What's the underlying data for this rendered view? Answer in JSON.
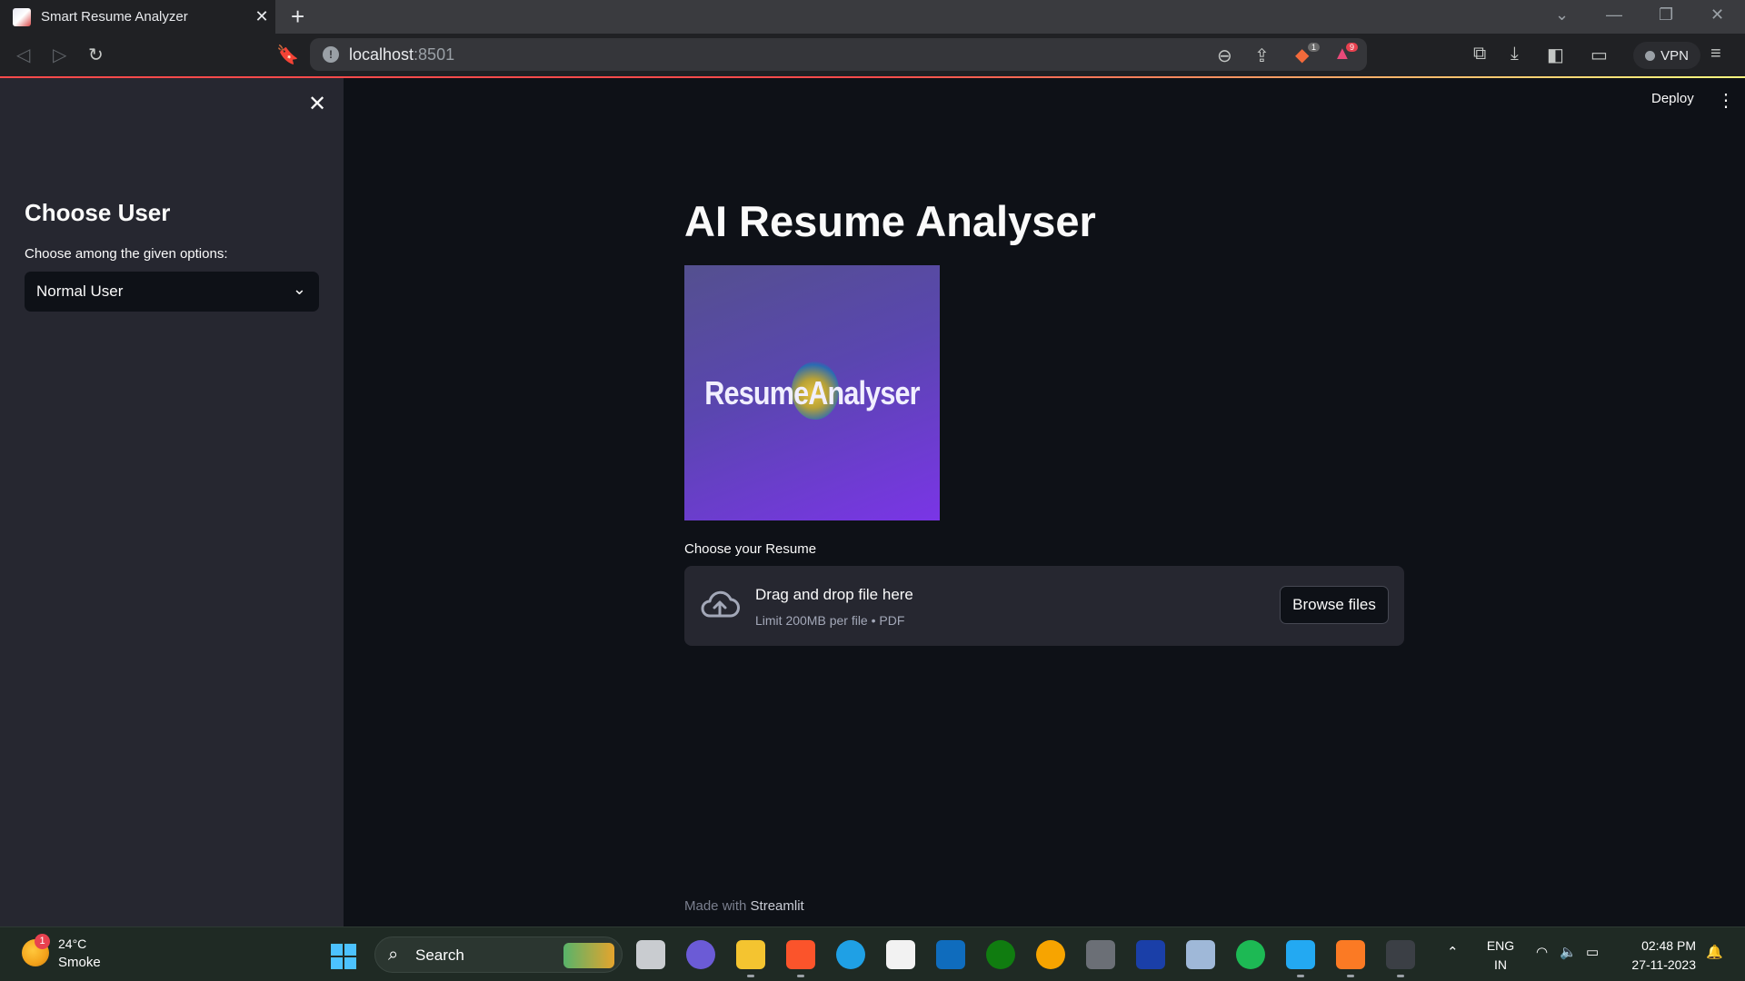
{
  "browser": {
    "tab_title": "Smart Resume Analyzer",
    "url_host": "localhost",
    "url_port": ":8501",
    "vpn_label": "VPN",
    "shield_count": "1",
    "alert_count": "9"
  },
  "header": {
    "deploy_label": "Deploy"
  },
  "sidebar": {
    "title": "Choose User",
    "select_label": "Choose among the given options:",
    "select_value": "Normal User"
  },
  "main": {
    "title": "AI Resume Analyser",
    "hero_logo_text": "ResumeAnalyser",
    "uploader": {
      "label": "Choose your Resume",
      "drop_text": "Drag and drop file here",
      "limit_text": "Limit 200MB per file • PDF",
      "browse_label": "Browse files"
    },
    "footer": {
      "prefix": "Made with ",
      "brand": "Streamlit"
    }
  },
  "taskbar": {
    "weather_badge": "1",
    "weather_temp": "24°C",
    "weather_condition": "Smoke",
    "search_label": "Search",
    "lang_line1": "ENG",
    "lang_line2": "IN",
    "time": "02:48 PM",
    "date": "27-11-2023"
  },
  "colors": {
    "app_bg": "#0e1117",
    "sidebar_bg": "#262730",
    "accent_red": "#ff4b4b",
    "hero_purple": "#7a35e6"
  }
}
